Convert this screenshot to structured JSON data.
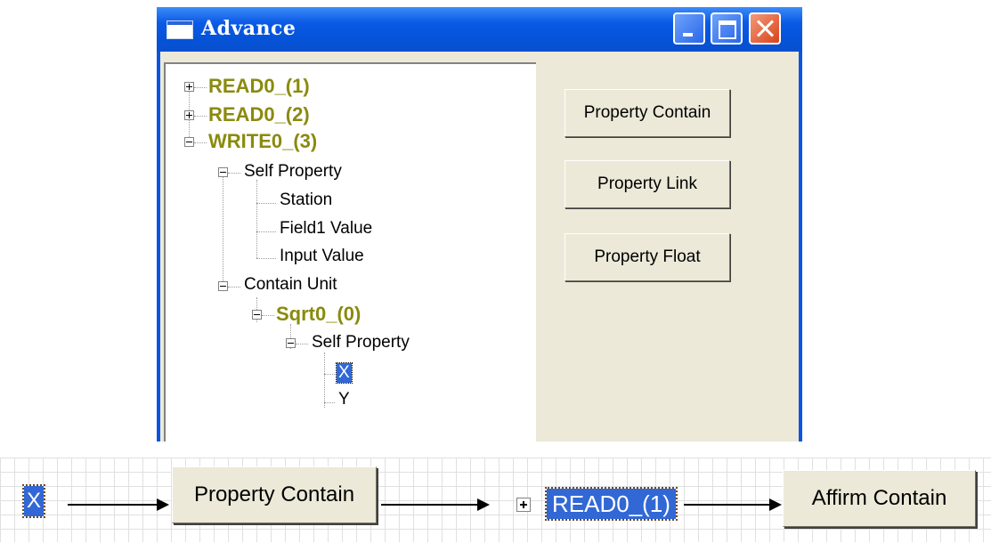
{
  "window": {
    "title": "Advance",
    "icon": "window-app-icon",
    "controls": [
      "minimize-icon",
      "maximize-icon",
      "close-icon"
    ],
    "titlebar_color": "#0a5ae6",
    "client_color": "#ece9d8"
  },
  "tree": {
    "read0_1": "READ0_(1)",
    "read0_2": "READ0_(2)",
    "write0_3": "WRITE0_(3)",
    "self_property": "Self Property",
    "station": "Station",
    "field1_value": "Field1 Value",
    "input_value": "Input Value",
    "contain_unit": "Contain Unit",
    "sqrt0_0": "Sqrt0_(0)",
    "sqrt_self_property": "Self Property",
    "x": "X",
    "y": "Y",
    "unit_label_color": "#8a8a0e",
    "selection_color": "#3168d5"
  },
  "buttons": {
    "property_contain": "Property Contain",
    "property_link": "Property Link",
    "property_float": "Property Float"
  },
  "flow": {
    "selected_item": "X",
    "step1": "Property Contain",
    "target": "READ0_(1)",
    "step2": "Affirm Contain"
  }
}
